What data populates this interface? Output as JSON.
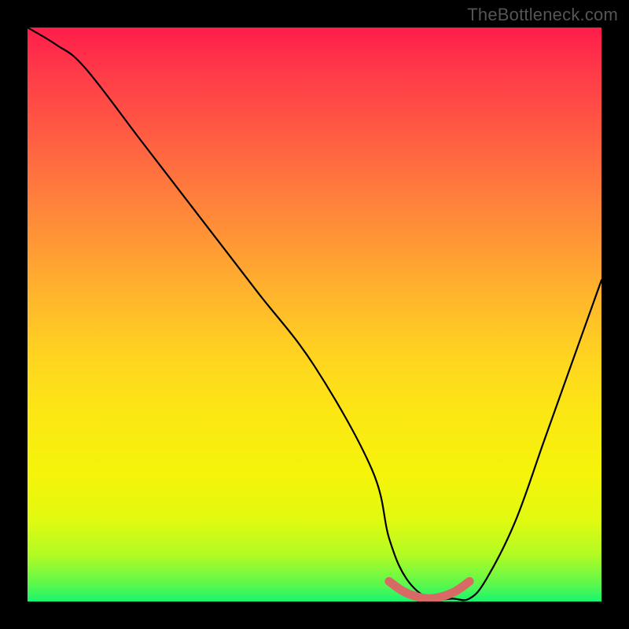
{
  "watermark": "TheBottleneck.com",
  "chart_data": {
    "type": "line",
    "title": "",
    "xlabel": "",
    "ylabel": "",
    "xlim": [
      0,
      100
    ],
    "ylim": [
      0,
      100
    ],
    "series": [
      {
        "name": "bottleneck-curve",
        "x": [
          0,
          5,
          10,
          20,
          30,
          40,
          50,
          60,
          63,
          66,
          70,
          74,
          77,
          80,
          85,
          90,
          95,
          100
        ],
        "values": [
          100,
          97,
          93,
          80,
          67,
          54,
          41,
          23,
          11,
          4,
          0.5,
          0.5,
          0.5,
          4,
          14,
          28,
          42,
          56
        ]
      },
      {
        "name": "bottleneck-floor-highlight",
        "x": [
          63,
          66,
          70,
          74,
          77
        ],
        "values": [
          3.5,
          1.5,
          0.5,
          1.5,
          3.5
        ]
      }
    ],
    "gradient_stops": [
      {
        "pos": 0,
        "color": "#ff1d4a"
      },
      {
        "pos": 50,
        "color": "#ffd61f"
      },
      {
        "pos": 100,
        "color": "#18f56f"
      }
    ]
  }
}
